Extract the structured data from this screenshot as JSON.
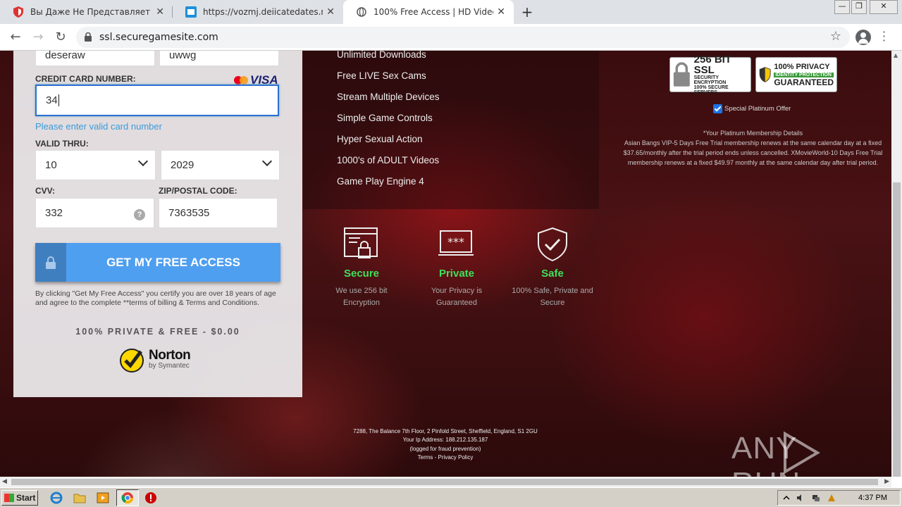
{
  "tabs": [
    {
      "title": "Вы Даже Не Представляете Что М"
    },
    {
      "title": "https://vozmj.deiicatedates.net/c/d"
    },
    {
      "title": "100% Free Access | HD Videos"
    }
  ],
  "address_bar": {
    "url": "ssl.securegamesite.com"
  },
  "form": {
    "first_name_value": "deseraw",
    "last_name_value": "uwwg",
    "card_label": "CREDIT CARD NUMBER:",
    "card_value": "34",
    "card_error": "Please enter valid card number",
    "valid_thru_label": "VALID THRU:",
    "month_value": "10",
    "year_value": "2029",
    "cvv_label": "CVV:",
    "cvv_value": "332",
    "zip_label": "ZIP/POSTAL CODE:",
    "zip_value": "7363535",
    "cta_label": "GET MY FREE ACCESS",
    "disclaimer": "By clicking \"Get My Free Access\" you certify you are over 18 years of age and agree to the complete **terms of billing & Terms and Conditions.",
    "private_text": "100% PRIVATE & FREE - $0.00",
    "visa_text": "VISA",
    "norton_brand": "Norton",
    "norton_sub": "by Symantec"
  },
  "features": [
    "Unlimited Downloads",
    "Free LIVE Sex Cams",
    "Stream Multiple Devices",
    "Simple Game Controls",
    "Hyper Sexual Action",
    "1000's of ADULT Videos",
    "Game Play Engine 4"
  ],
  "badges": [
    {
      "title": "Secure",
      "desc_line1": "We use 256 bit",
      "desc_line2": "Encryption"
    },
    {
      "title": "Private",
      "desc_line1": "Your Privacy is",
      "desc_line2": "Guaranteed"
    },
    {
      "title": "Safe",
      "desc_line1": "100% Safe, Private and",
      "desc_line2": "Secure"
    }
  ],
  "seals": {
    "ssl_big": "256 BIT SSL",
    "ssl_small1": "SECURITY ENCRYPTION",
    "ssl_small2": "100% SECURE SERVERS",
    "privacy_big1": "100% PRIVACY",
    "privacy_small": "IDENTITY PROTECTION",
    "privacy_big2": "GUARANTEED"
  },
  "offer": {
    "label": "Special Platinum Offer",
    "checked": true
  },
  "terms": {
    "heading": "*Your Platinum Membership Details",
    "body": "Asian Bangs VIP-5 Days Free Trial membership renews at the same calendar day at a fixed $37.65/monthly after the trial period ends unless cancelled. XMovieWorld-10 Days Free Trial membership renews at a fixed $49.97 monthly at the same calendar day after trial period."
  },
  "footer": {
    "address": "7288, The Balance 7th Floor, 2 Pinfold Street, Sheffield, England, S1 2GU",
    "ip": "Your Ip Address: 188.212.135.187",
    "logged": "(logged for fraud prevention)",
    "links": "Terms - Privacy Policy"
  },
  "watermark": "ANY RUN",
  "taskbar": {
    "start_label": "Start",
    "time": "4:37 PM"
  },
  "colors": {
    "accent_blue": "#4f9ff0",
    "badge_green": "#3fe05a",
    "error_blue": "#3a9ad9"
  }
}
